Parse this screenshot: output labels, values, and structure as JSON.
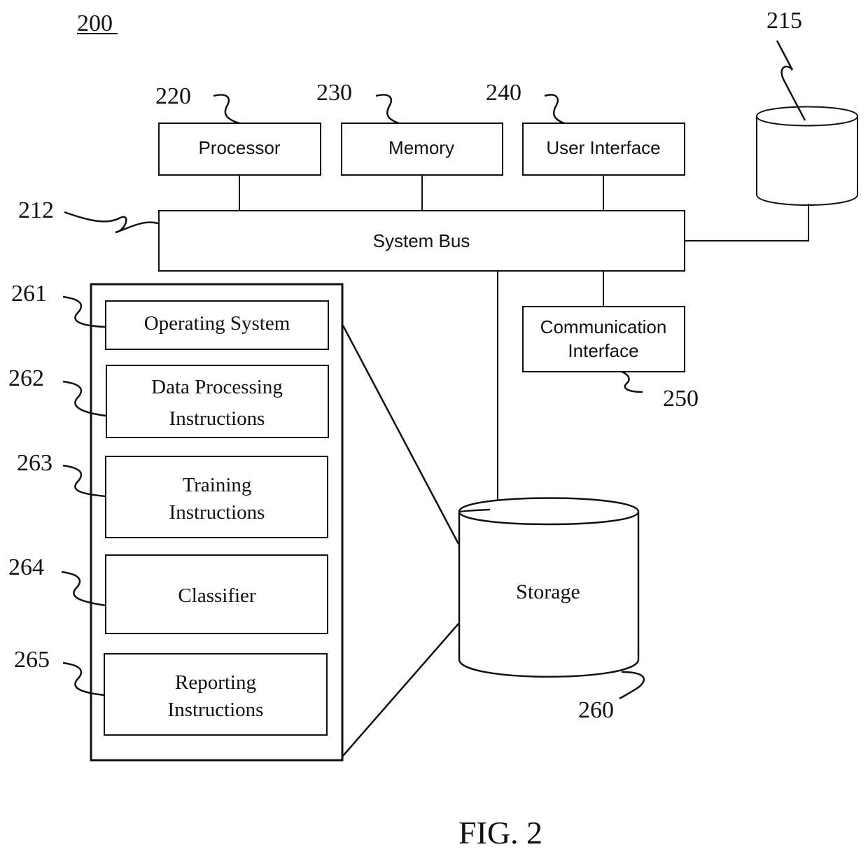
{
  "figure": {
    "number_label": "200",
    "caption": "FIG. 2"
  },
  "components": {
    "processor": {
      "ref": "220",
      "label": "Processor"
    },
    "memory": {
      "ref": "230",
      "label": "Memory"
    },
    "user_interface": {
      "ref": "240",
      "label": "User Interface"
    },
    "system_bus": {
      "ref": "212",
      "label": "System Bus"
    },
    "external_db": {
      "ref": "215",
      "label": ""
    },
    "communication_interface": {
      "ref": "250",
      "label_line1": "Communication",
      "label_line2": "Interface"
    },
    "storage": {
      "ref": "260",
      "label": "Storage"
    }
  },
  "storage_contents": [
    {
      "ref": "261",
      "lines": [
        "Operating System"
      ]
    },
    {
      "ref": "262",
      "lines": [
        "Data Processing",
        "Instructions"
      ]
    },
    {
      "ref": "263",
      "lines": [
        "Training",
        "Instructions"
      ]
    },
    {
      "ref": "264",
      "lines": [
        "Classifier"
      ]
    },
    {
      "ref": "265",
      "lines": [
        "Reporting",
        "Instructions"
      ]
    }
  ]
}
